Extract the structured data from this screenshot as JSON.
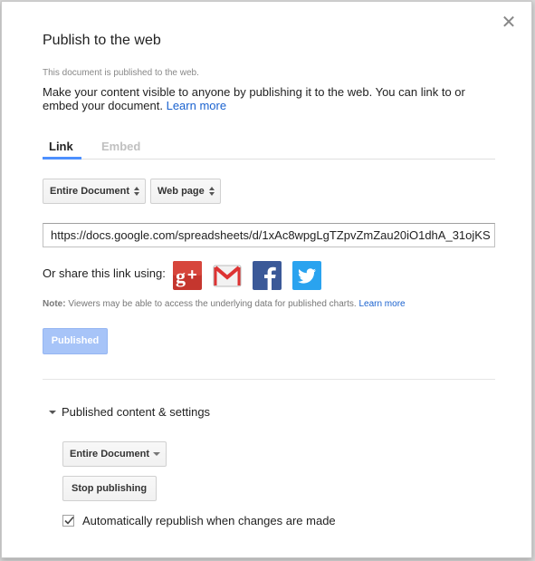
{
  "dialog": {
    "title": "Publish to the web",
    "close_icon": "close-icon",
    "status_text": "This document is published to the web.",
    "description": "Make your content visible to anyone by publishing it to the web. You can link to or embed your document.",
    "learn_more": "Learn more"
  },
  "tabs": [
    {
      "label": "Link",
      "active": true
    },
    {
      "label": "Embed",
      "active": false
    }
  ],
  "selects": {
    "scope": "Entire Document",
    "format": "Web page"
  },
  "url_value": "https://docs.google.com/spreadsheets/d/1xAc8wpgLgTZpvZmZau20iO1dhA_31ojKS",
  "share": {
    "label": "Or share this link using:",
    "icons": [
      "google-plus-icon",
      "gmail-icon",
      "facebook-icon",
      "twitter-icon"
    ]
  },
  "note": {
    "bold": "Note:",
    "text": " Viewers may be able to access the underlying data for published charts. ",
    "link": "Learn more"
  },
  "published_button": "Published",
  "settings": {
    "section_label": "Published content & settings",
    "scope": "Entire Document",
    "stop_button": "Stop publishing",
    "auto_republish_label": "Automatically republish when changes are made",
    "auto_republish_checked": true
  },
  "colors": {
    "accent": "#4d90fe",
    "link": "#1a62cf",
    "published_bg": "#a7c4f8"
  }
}
